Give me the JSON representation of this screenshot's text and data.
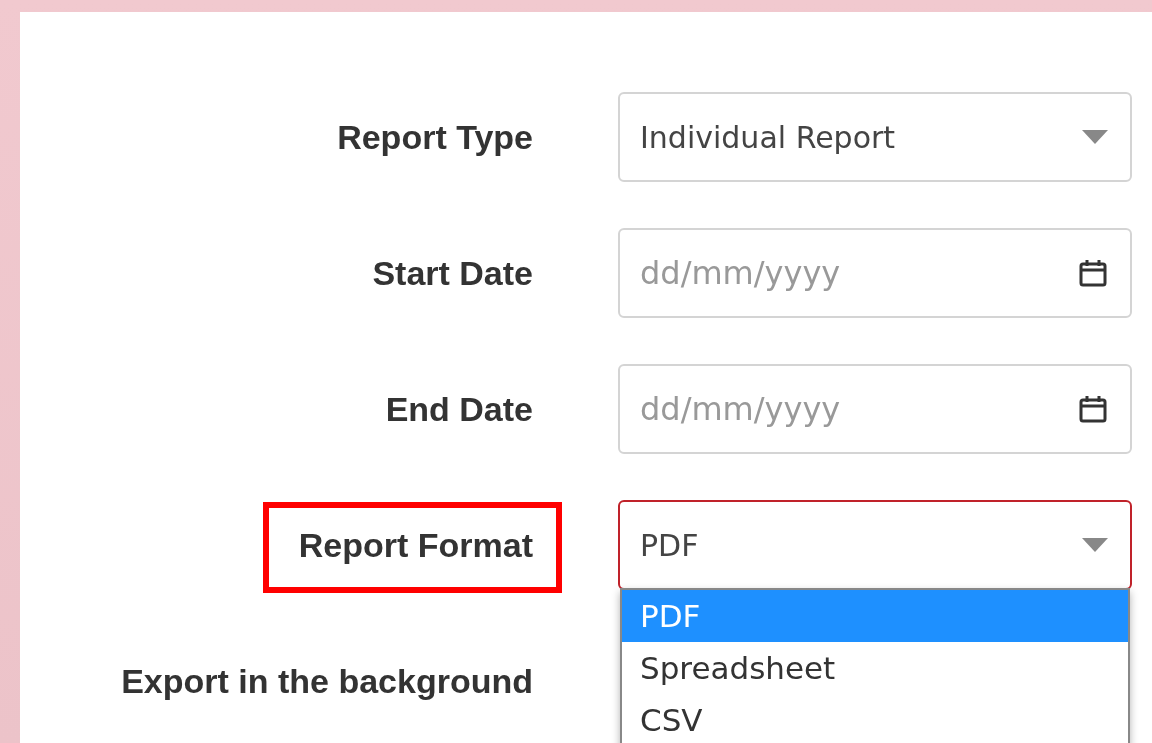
{
  "fields": [
    {
      "label": "Report Type",
      "kind": "select",
      "value": "Individual Report"
    },
    {
      "label": "Start Date",
      "kind": "date",
      "placeholder": "dd/mm/yyyy"
    },
    {
      "label": "End Date",
      "kind": "date",
      "placeholder": "dd/mm/yyyy"
    },
    {
      "label": "Report Format",
      "kind": "select",
      "value": "PDF",
      "highlighted": true,
      "expanded": true,
      "options": [
        {
          "label": "PDF",
          "selected": true
        },
        {
          "label": "Spreadsheet",
          "selected": false
        },
        {
          "label": "CSV",
          "selected": false
        }
      ]
    },
    {
      "label": "Export in the background",
      "kind": "plain"
    }
  ]
}
